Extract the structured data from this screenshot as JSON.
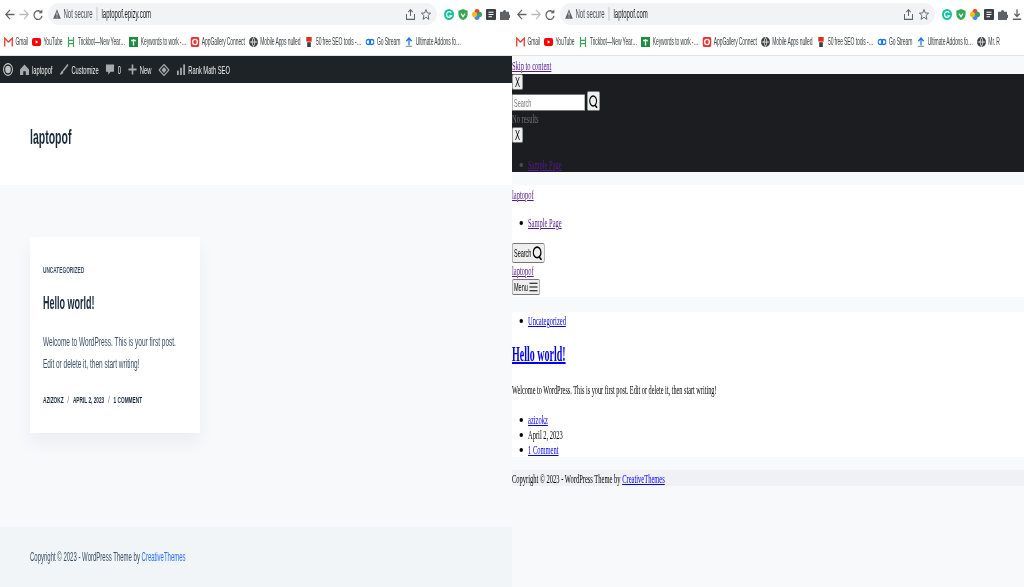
{
  "windows": [
    {
      "kind": "styled",
      "address_bar": {
        "security": "Not secure",
        "url": "laptopof.epizy.com"
      },
      "bookmarks": [
        "Gmail",
        "YouTube",
        "Trickbot—New Year…",
        "Keywords to work -…",
        "AppGallery Connect",
        "Mobile Apps nulled",
        "50 free SEO tools -…",
        "Go Stream",
        "Ultimate Addons fo…"
      ],
      "page": {
        "admin_bar": [
          {
            "kind": "wordpress"
          },
          {
            "kind": "site",
            "label": "laptopof"
          },
          {
            "kind": "customize",
            "label": "Customize"
          },
          {
            "kind": "comments",
            "label": "0"
          },
          {
            "kind": "new",
            "label": "New"
          },
          {
            "kind": "plugin"
          },
          {
            "kind": "seo",
            "label": "Rank Math SEO"
          }
        ],
        "site_title": "laptopof",
        "post": {
          "category": "UNCATEGORIZED",
          "title": "Hello world!",
          "excerpt": "Welcome to WordPress. This is your first post. Edit or delete it, then start writing!",
          "meta": [
            {
              "kind": "link",
              "label": "AZIZOKZ"
            },
            {
              "kind": "separator",
              "label": "/"
            },
            {
              "kind": "text",
              "label": "APRIL 2, 2023"
            },
            {
              "kind": "separator",
              "label": "/"
            },
            {
              "kind": "link",
              "label": "1 COMMENT"
            }
          ]
        },
        "footer": {
          "text": "Copyright © 2023 - WordPress Theme by",
          "link": {
            "label": "CreativeThemes"
          }
        }
      }
    },
    {
      "kind": "unstyled",
      "address_bar": {
        "security": "Not secure",
        "url": "laptopof.com"
      },
      "bookmarks": [
        "Gmail",
        "YouTube",
        "Trickbot—New Year…",
        "Keywords to work -…",
        "AppGallery Connect",
        "Mobile Apps nulled",
        "50 free SEO tools -…",
        "Go Stream",
        "Ultimate Addons fo…",
        "Mr. R"
      ],
      "page": {
        "skip_link": {
          "label": "Skip to content",
          "visited": true
        },
        "panel": {
          "close_button": "X",
          "search_field": {
            "placeholder": "Search"
          },
          "message": "No results",
          "second_close_button": "X",
          "menu": [
            {
              "label": "Sample Page",
              "visited": true
            }
          ]
        },
        "header": {
          "site_link": {
            "label": "laptopof",
            "visited": true
          },
          "menu": [
            {
              "label": "Sample Page",
              "visited": true
            }
          ],
          "search_button": "Search",
          "mobile_site_link": {
            "label": "laptopof",
            "visited": true
          },
          "menu_button": "Menu"
        },
        "post": {
          "categories": [
            {
              "label": "Uncategorized",
              "visited": false
            }
          ],
          "title": {
            "label": "Hello world!",
            "visited": false
          },
          "excerpt": "Welcome to WordPress. This is your first post. Edit or delete it, then start writing!",
          "meta": [
            {
              "kind": "link",
              "label": "azizokz",
              "visited": false
            },
            {
              "kind": "text",
              "label": "April 2, 2023"
            },
            {
              "kind": "link",
              "label": "1 Comment",
              "visited": false
            }
          ]
        },
        "footer": {
          "text": "Copyright © 2023 - WordPress Theme by",
          "link": {
            "label": "CreativeThemes",
            "visited": false
          }
        }
      }
    }
  ]
}
